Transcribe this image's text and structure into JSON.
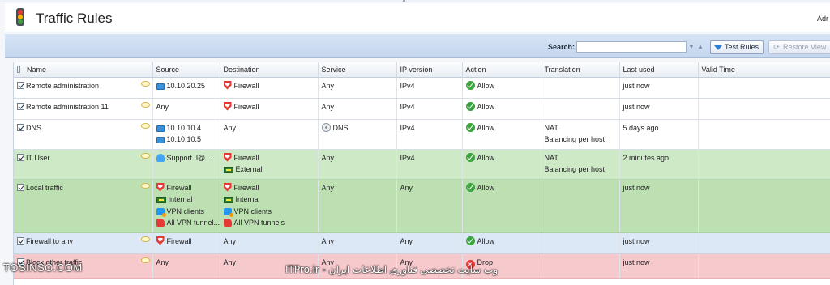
{
  "app": {
    "title": "Traffic Rules",
    "user": "Adr"
  },
  "toolbar": {
    "search_label": "Search:",
    "search_value": "",
    "test_rules": "Test Rules",
    "restore_view": "Restore View"
  },
  "columns": [
    "Name",
    "Source",
    "Destination",
    "Service",
    "IP version",
    "Action",
    "Translation",
    "Last used",
    "Valid Time"
  ],
  "rules": [
    {
      "name": "Remote administration",
      "source": [
        {
          "icon": "monitor-icon",
          "text": "10.10.20.25"
        }
      ],
      "destination": [
        {
          "icon": "shield-icon",
          "text": "Firewall"
        }
      ],
      "service": [
        {
          "icon": "",
          "text": "Any"
        }
      ],
      "ip_version": "IPv4",
      "action": {
        "icon": "allow-icon",
        "text": "Allow"
      },
      "translation": [],
      "last_used": "just now",
      "valid_time": ""
    },
    {
      "name": "Remote administration 11",
      "source": [
        {
          "icon": "",
          "text": "Any"
        }
      ],
      "destination": [
        {
          "icon": "shield-icon",
          "text": "Firewall"
        }
      ],
      "service": [
        {
          "icon": "",
          "text": "Any"
        }
      ],
      "ip_version": "IPv4",
      "action": {
        "icon": "allow-icon",
        "text": "Allow"
      },
      "translation": [],
      "last_used": "just now",
      "valid_time": ""
    },
    {
      "name": "DNS",
      "source": [
        {
          "icon": "monitor-icon",
          "text": "10.10.10.4"
        },
        {
          "icon": "monitor-icon",
          "text": "10.10.10.5"
        }
      ],
      "destination": [
        {
          "icon": "",
          "text": "Any"
        }
      ],
      "service": [
        {
          "icon": "dns-icon",
          "text": "DNS"
        }
      ],
      "ip_version": "IPv4",
      "action": {
        "icon": "allow-icon",
        "text": "Allow"
      },
      "translation": [
        "NAT",
        "Balancing per host"
      ],
      "last_used": "5 days ago",
      "valid_time": ""
    },
    {
      "name": "IT User",
      "source": [
        {
          "icon": "user-icon",
          "text": "Support  l@..."
        }
      ],
      "destination": [
        {
          "icon": "shield-icon",
          "text": "Firewall"
        },
        {
          "icon": "network-icon",
          "text": "External"
        }
      ],
      "service": [
        {
          "icon": "",
          "text": "Any"
        }
      ],
      "ip_version": "IPv4",
      "action": {
        "icon": "allow-icon",
        "text": "Allow"
      },
      "translation": [
        "NAT",
        "Balancing per host"
      ],
      "last_used": "2 minutes ago",
      "valid_time": ""
    },
    {
      "name": "Local traffic",
      "source": [
        {
          "icon": "shield-icon",
          "text": "Firewall"
        },
        {
          "icon": "network-icon",
          "text": "Internal"
        },
        {
          "icon": "vpn-clients-icon",
          "text": "VPN clients"
        },
        {
          "icon": "vpn-tunnels-icon",
          "text": "All VPN tunnel..."
        }
      ],
      "destination": [
        {
          "icon": "shield-icon",
          "text": "Firewall"
        },
        {
          "icon": "network-icon",
          "text": "Internal"
        },
        {
          "icon": "vpn-clients-icon",
          "text": "VPN clients"
        },
        {
          "icon": "vpn-tunnels-icon",
          "text": "All VPN tunnels"
        }
      ],
      "service": [
        {
          "icon": "",
          "text": "Any"
        }
      ],
      "ip_version": "Any",
      "action": {
        "icon": "allow-icon",
        "text": "Allow"
      },
      "translation": [],
      "last_used": "just now",
      "valid_time": ""
    },
    {
      "name": "Firewall to any",
      "source": [
        {
          "icon": "shield-icon",
          "text": "Firewall"
        }
      ],
      "destination": [
        {
          "icon": "",
          "text": "Any"
        }
      ],
      "service": [
        {
          "icon": "",
          "text": "Any"
        }
      ],
      "ip_version": "Any",
      "action": {
        "icon": "allow-icon",
        "text": "Allow"
      },
      "translation": [],
      "last_used": "just now",
      "valid_time": ""
    },
    {
      "name": "Block other traffic",
      "source": [
        {
          "icon": "",
          "text": "Any"
        }
      ],
      "destination": [
        {
          "icon": "",
          "text": "Any"
        }
      ],
      "service": [
        {
          "icon": "",
          "text": "Any"
        }
      ],
      "ip_version": "Any",
      "action": {
        "icon": "drop-icon",
        "text": "Drop"
      },
      "translation": [],
      "last_used": "just now",
      "valid_time": ""
    }
  ],
  "watermarks": {
    "left": "TOSINSO.COM",
    "right": "ITPro.ir - وب سایت تخصصی فناوری اطلاعات ایران"
  }
}
